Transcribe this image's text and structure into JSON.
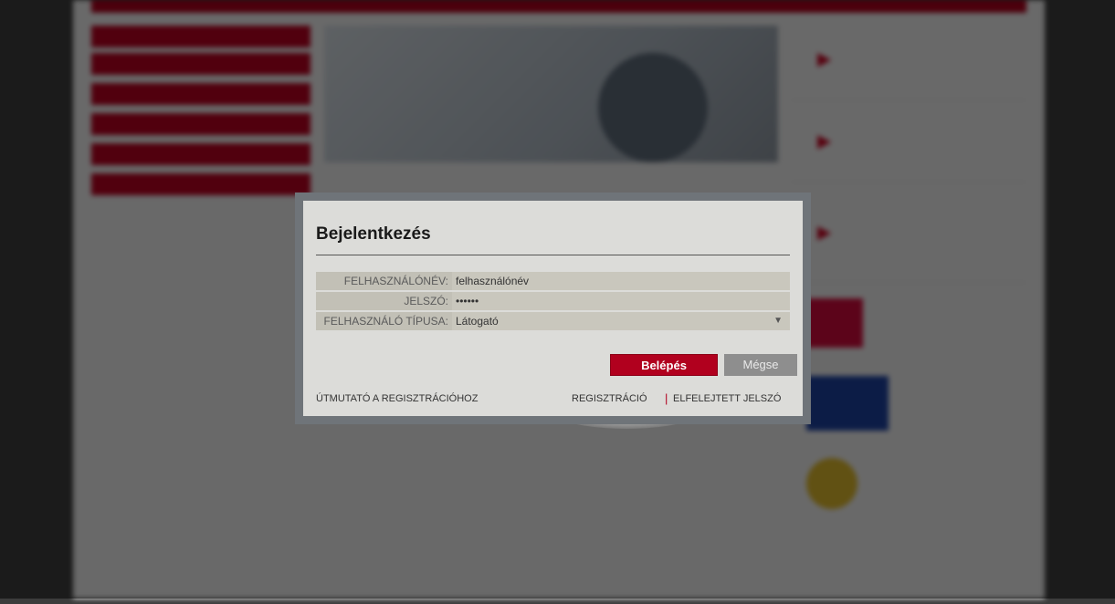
{
  "background": {
    "left_menu": [
      "",
      "",
      "",
      "",
      "",
      "",
      ""
    ],
    "right_tiles": [
      "",
      "",
      ""
    ],
    "logos": [
      "",
      "",
      "",
      ""
    ]
  },
  "dialog": {
    "title": "Bejelentkezés",
    "fields": [
      {
        "label": "FELHASZNÁLÓNÉV:",
        "value": "felhasználónév"
      },
      {
        "label": "JELSZÓ:",
        "value": "••••••"
      },
      {
        "label": "FELHASZNÁLÓ TÍPUSA:",
        "value": "Látogató"
      }
    ],
    "select_arrow": "▼",
    "buttons": {
      "login": "Belépés",
      "cancel": "Mégse"
    },
    "links": {
      "guide": "ÚTMUTATÓ A REGISZTRÁCIÓHOZ",
      "register": "REGISZTRÁCIÓ",
      "separator": "|",
      "forgot": "ELFELEJTETT JELSZÓ"
    }
  },
  "colors": {
    "accent": "#b1001e",
    "dialog_bg": "#dcdcd9",
    "frame": "#6f7479"
  }
}
